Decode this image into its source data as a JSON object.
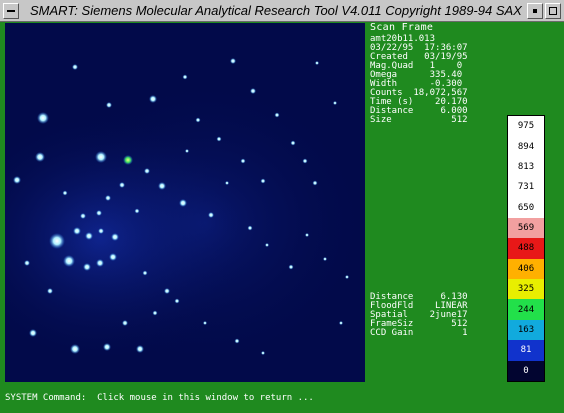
{
  "window": {
    "title": "SMART: Siemens Molecular Analytical Research Tool V4.011 Copyright 1989-94 SAX",
    "title_bar_icons": [
      "window-menu-icon",
      "minimize-icon",
      "maximize-icon"
    ]
  },
  "info": {
    "header": "Scan Frame",
    "lines": [
      "amt20b11.013",
      "03/22/95  17:36:07",
      "Created   03/19/95",
      "Mag.Quad   1    0",
      "Omega      335.40",
      "Width      -0.300",
      "Counts  18,072,567",
      "Time (s)    20.170",
      "Distance     6.000",
      "Size           512"
    ],
    "setup_lines": [
      "Distance     6.130",
      "FloodFld    LINEAR",
      "Spatial    2june17",
      "FrameSiz       512",
      "CCD Gain         1"
    ]
  },
  "colorbar": {
    "segments": [
      {
        "label": "975",
        "color": "#ffffff",
        "light_text": false
      },
      {
        "label": "894",
        "color": "#ffffff",
        "light_text": false
      },
      {
        "label": "813",
        "color": "#ffffff",
        "light_text": false
      },
      {
        "label": "731",
        "color": "#ffffff",
        "light_text": false
      },
      {
        "label": "650",
        "color": "#ffffff",
        "light_text": false
      },
      {
        "label": "569",
        "color": "#f2a0a0",
        "light_text": false
      },
      {
        "label": "488",
        "color": "#e81818",
        "light_text": false
      },
      {
        "label": "406",
        "color": "#ffb000",
        "light_text": false
      },
      {
        "label": "325",
        "color": "#e8ee00",
        "light_text": false
      },
      {
        "label": "244",
        "color": "#22e04a",
        "light_text": false
      },
      {
        "label": "163",
        "color": "#11aadd",
        "light_text": false
      },
      {
        "label": "81",
        "color": "#1133cc",
        "light_text": true
      },
      {
        "label": "0",
        "color": "#020530",
        "light_text": true
      }
    ]
  },
  "command": {
    "text": "SYSTEM Command:  Click mouse in this window to return ..."
  }
}
